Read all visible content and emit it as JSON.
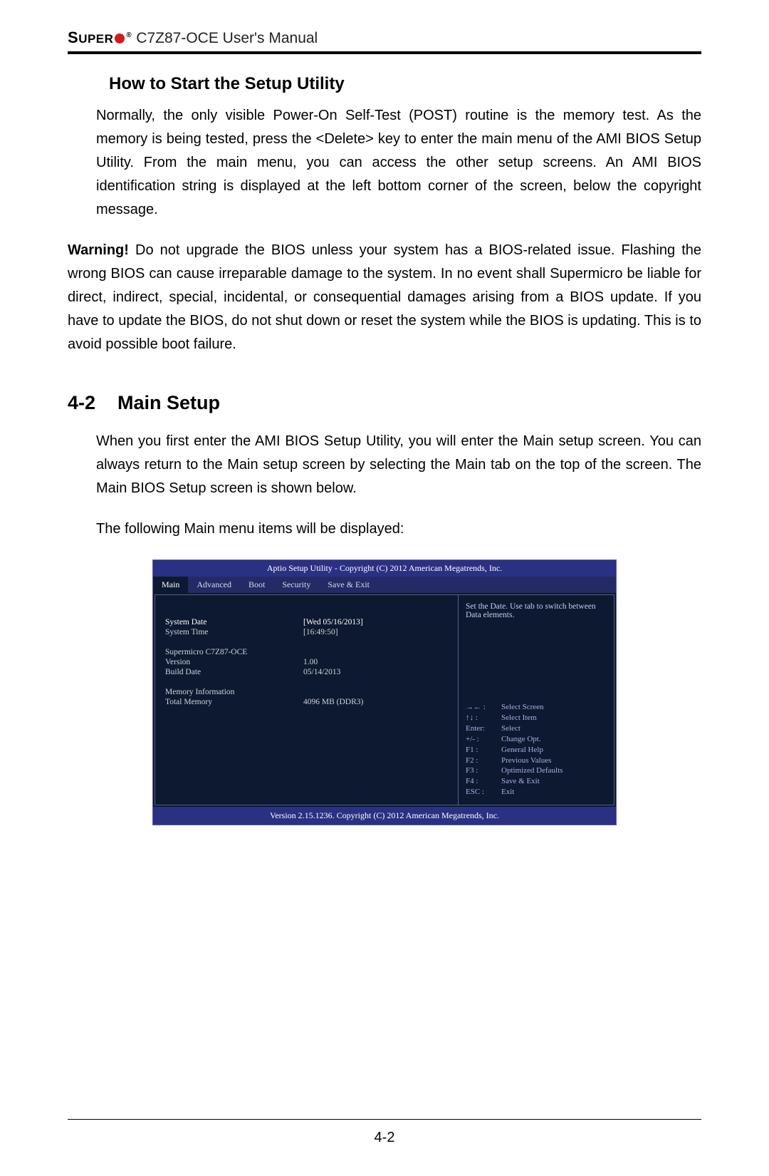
{
  "header": {
    "brand_prefix": "S",
    "brand_rest": "UPER",
    "product": "C7Z87-OCE User's Manual"
  },
  "intro": {
    "subhead": "How to Start the Setup Utility",
    "para1": "Normally, the only visible Power-On Self-Test (POST) routine is the memory test. As the memory is being tested, press the <Delete> key to enter the main menu of the AMI BIOS Setup Utility. From the main menu, you can access the other setup screens. An AMI BIOS identification string is displayed at the left bottom corner of the screen, below the copyright message."
  },
  "warning": {
    "label": "Warning!",
    "text": " Do not upgrade the BIOS unless your system has a BIOS-related issue. Flashing the wrong BIOS can cause irreparable damage to the system. In no event shall Supermicro be liable for direct, indirect, special, incidental, or consequential damages arising from a BIOS update. If you have to update the BIOS, do not shut down or reset the system while the BIOS is updating. This is to avoid possible boot failure."
  },
  "section": {
    "num": "4-2",
    "title": "Main Setup",
    "para1": "When you first enter the AMI BIOS Setup Utility, you will enter the Main setup screen. You can always return to the Main setup screen by selecting the Main tab on the top of the screen. The Main BIOS Setup screen is shown below.",
    "para2": "The following Main menu items will be displayed:"
  },
  "bios": {
    "top": "Aptio Setup Utility - Copyright (C) 2012 American Megatrends, Inc.",
    "tabs": [
      "Main",
      "Advanced",
      "Boot",
      "Security",
      "Save & Exit"
    ],
    "help_text": "Set the Date.  Use tab to switch between Data elements.",
    "fields": {
      "date_label": "System Date",
      "date_value": "[Wed 05/16/2013]",
      "time_label": "System Time",
      "time_value": "[16:49:50]",
      "board": "Supermicro C7Z87-OCE",
      "version_label": "Version",
      "version_value": "1.00",
      "build_label": "Build Date",
      "build_value": "05/14/2013",
      "mem_header": "Memory Information",
      "mem_label": "Total Memory",
      "mem_value": "4096 MB (DDR3)"
    },
    "keys": [
      {
        "k": "→← :",
        "v": "Select Screen"
      },
      {
        "k": "↑↓ :",
        "v": "Select Item"
      },
      {
        "k": "Enter:",
        "v": "Select"
      },
      {
        "k": "+/- :",
        "v": "Change Opt."
      },
      {
        "k": "F1 :",
        "v": "General Help"
      },
      {
        "k": "F2 :",
        "v": "Previous Values"
      },
      {
        "k": "F3 :",
        "v": "Optimized Defaults"
      },
      {
        "k": "F4 :",
        "v": "Save & Exit"
      },
      {
        "k": "ESC :",
        "v": "Exit"
      }
    ],
    "bottom": "Version 2.15.1236. Copyright (C) 2012 American Megatrends, Inc."
  },
  "footer": {
    "page": "4-2"
  }
}
